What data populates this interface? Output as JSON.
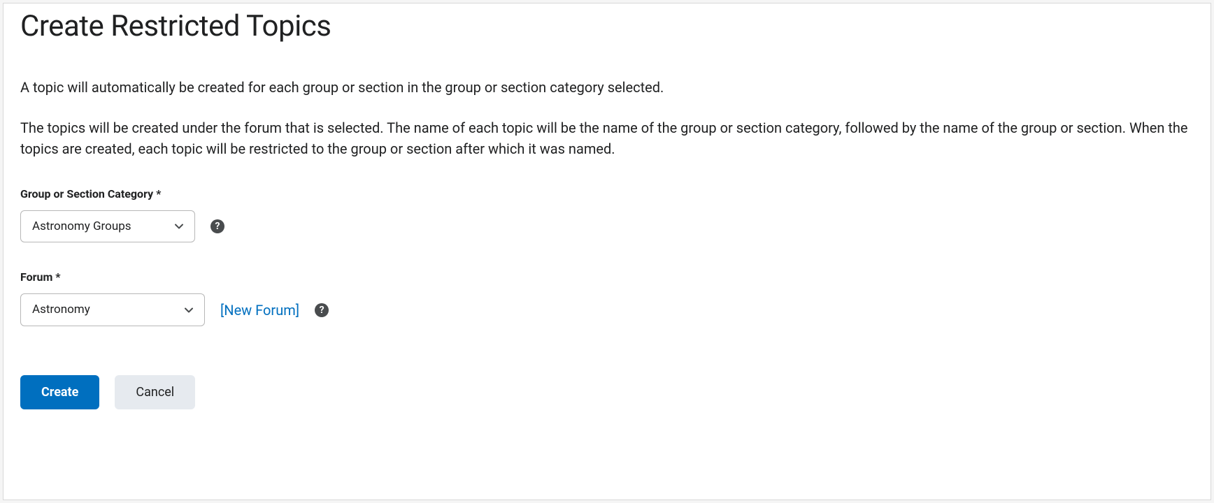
{
  "page": {
    "title": "Create Restricted Topics",
    "desc1": "A topic will automatically be created for each group or section in the group or section category selected.",
    "desc2": "The topics will be created under the forum that is selected. The name of each topic will be the name of the group or section category, followed by the name of the group or section. When the topics are created, each topic will be restricted to the group or section after which it was named."
  },
  "fields": {
    "category": {
      "label": "Group or Section Category *",
      "selected": "Astronomy Groups"
    },
    "forum": {
      "label": "Forum *",
      "selected": "Astronomy",
      "new_link": "[New Forum]"
    }
  },
  "buttons": {
    "create": "Create",
    "cancel": "Cancel"
  }
}
